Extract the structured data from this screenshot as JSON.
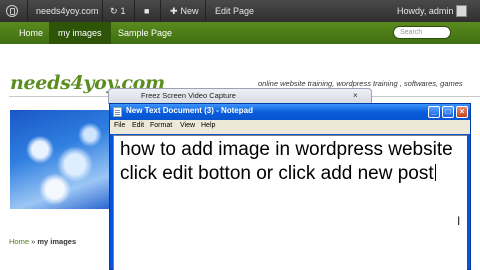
{
  "admin_bar": {
    "site_name": "needs4yoy.com",
    "updates_count": "1",
    "new_label": "New",
    "edit_page_label": "Edit Page",
    "howdy": "Howdy, admin"
  },
  "nav": {
    "items": [
      {
        "label": "Home"
      },
      {
        "label": "my images"
      },
      {
        "label": "Sample Page"
      }
    ],
    "active_index": 1,
    "search_placeholder": "Search"
  },
  "site": {
    "title": "needs4yoy.com",
    "tagline": "online website training, wordpress training , softwares, games"
  },
  "breadcrumb": {
    "home": "Home",
    "separator": "»",
    "current": "my images"
  },
  "capture_window": {
    "title": "Freez Screen Video Capture",
    "close": "×"
  },
  "notepad": {
    "title": "New Text Document (3) - Notepad",
    "menu": [
      "File",
      "Edit",
      "Format",
      "View",
      "Help"
    ],
    "content": "how to add image in wordpress website click edit botton or click add new post",
    "buttons": {
      "minimize": "_",
      "maximize": "□",
      "close": "×"
    }
  },
  "colors": {
    "nav_green": "#4f7f17",
    "title_green": "#5b8e1e",
    "xp_blue": "#0a5ddb"
  }
}
